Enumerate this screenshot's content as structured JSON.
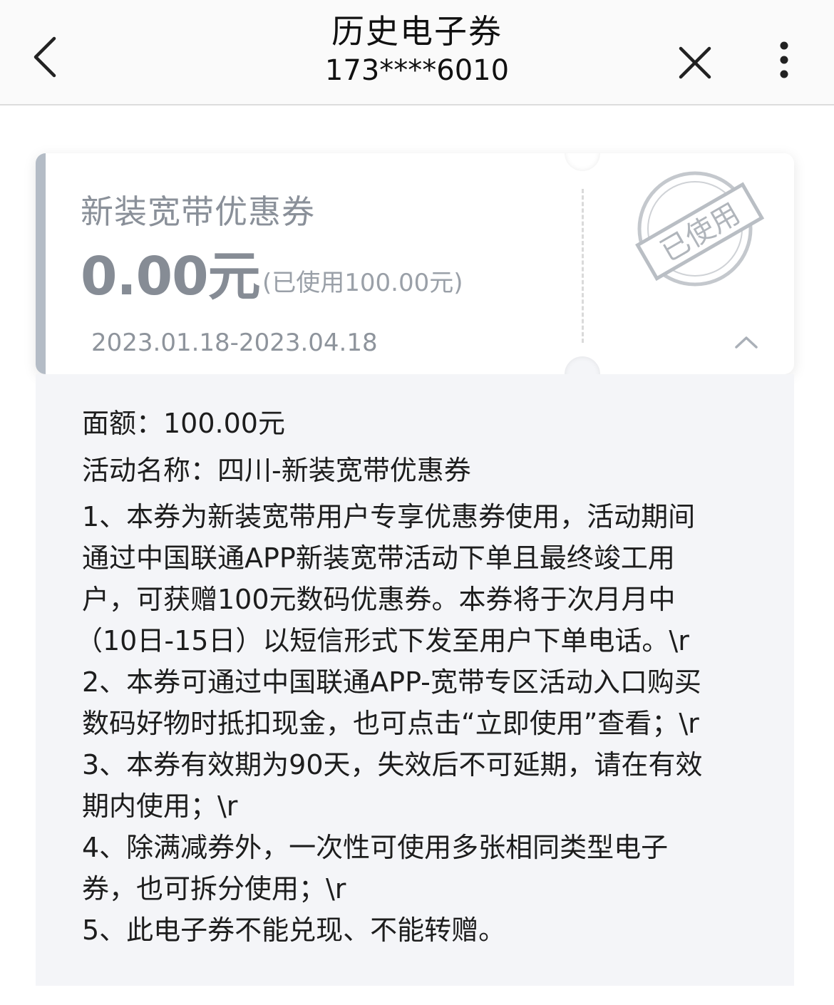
{
  "header": {
    "title": "历史电子券",
    "subtitle": "173****6010"
  },
  "coupon": {
    "name": "新装宽带优惠券",
    "amount": "0.00元",
    "used_note": "(已使用100.00元)",
    "period": "2023.01.18-2023.04.18",
    "stamp_text": "已使用"
  },
  "detail": {
    "lines": [
      "面额：100.00元",
      "活动名称：四川-新装宽带优惠券",
      "1、本券为新装宽带用户专享优惠券使用，活动期间",
      "通过中国联通APP新装宽带活动下单且最终竣工用",
      "户，可获赠100元数码优惠券。本券将于次月月中",
      "（10日-15日）以短信形式下发至用户下单电话。\\r",
      "2、本券可通过中国联通APP-宽带专区活动入口购买",
      "数码好物时抵扣现金，也可点击“立即使用”查看；\\r",
      "3、本券有效期为90天，失效后不可延期，请在有效",
      "期内使用；\\r",
      "4、除满减券外，一次性可使用多张相同类型电子",
      "券，也可拆分使用；\\r",
      "5、此电子券不能兑现、不能转赠。"
    ]
  },
  "icons": {
    "back": "chevron-left-icon",
    "close": "close-icon",
    "more": "more-vertical-icon",
    "collapse": "chevron-up-icon",
    "stamp": "used-stamp-icon"
  }
}
